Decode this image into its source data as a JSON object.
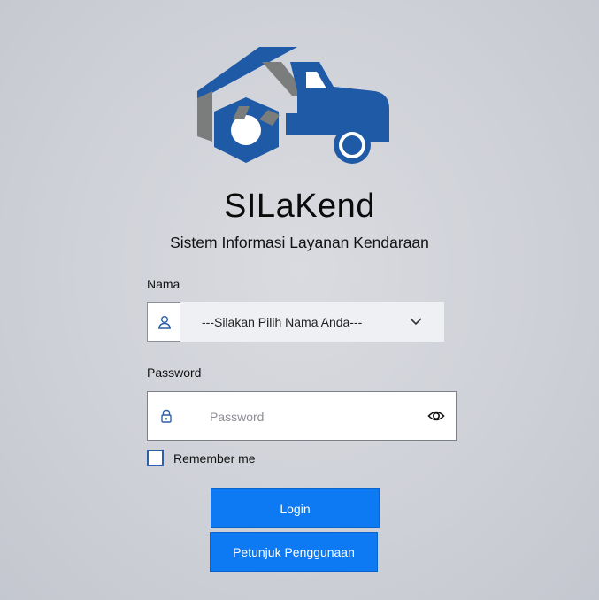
{
  "brand": {
    "title": "SILaKend",
    "subtitle": "Sistem Informasi Layanan Kendaraan",
    "logo_icon": "house-gear-truck-logo",
    "colors": {
      "blue": "#1f5aa6",
      "gray": "#7b7c7c"
    }
  },
  "form": {
    "nama_label": "Nama",
    "nama_select_value": "---Silakan Pilih Nama Anda---",
    "nama_icon": "user-icon",
    "password_label": "Password",
    "password_placeholder": "Password",
    "password_icon": "lock-icon",
    "toggle_icon": "eye-icon",
    "remember_label": "Remember me"
  },
  "buttons": {
    "login": "Login",
    "help": "Petunjuk Penggunaan",
    "color": "#0d79f2"
  }
}
